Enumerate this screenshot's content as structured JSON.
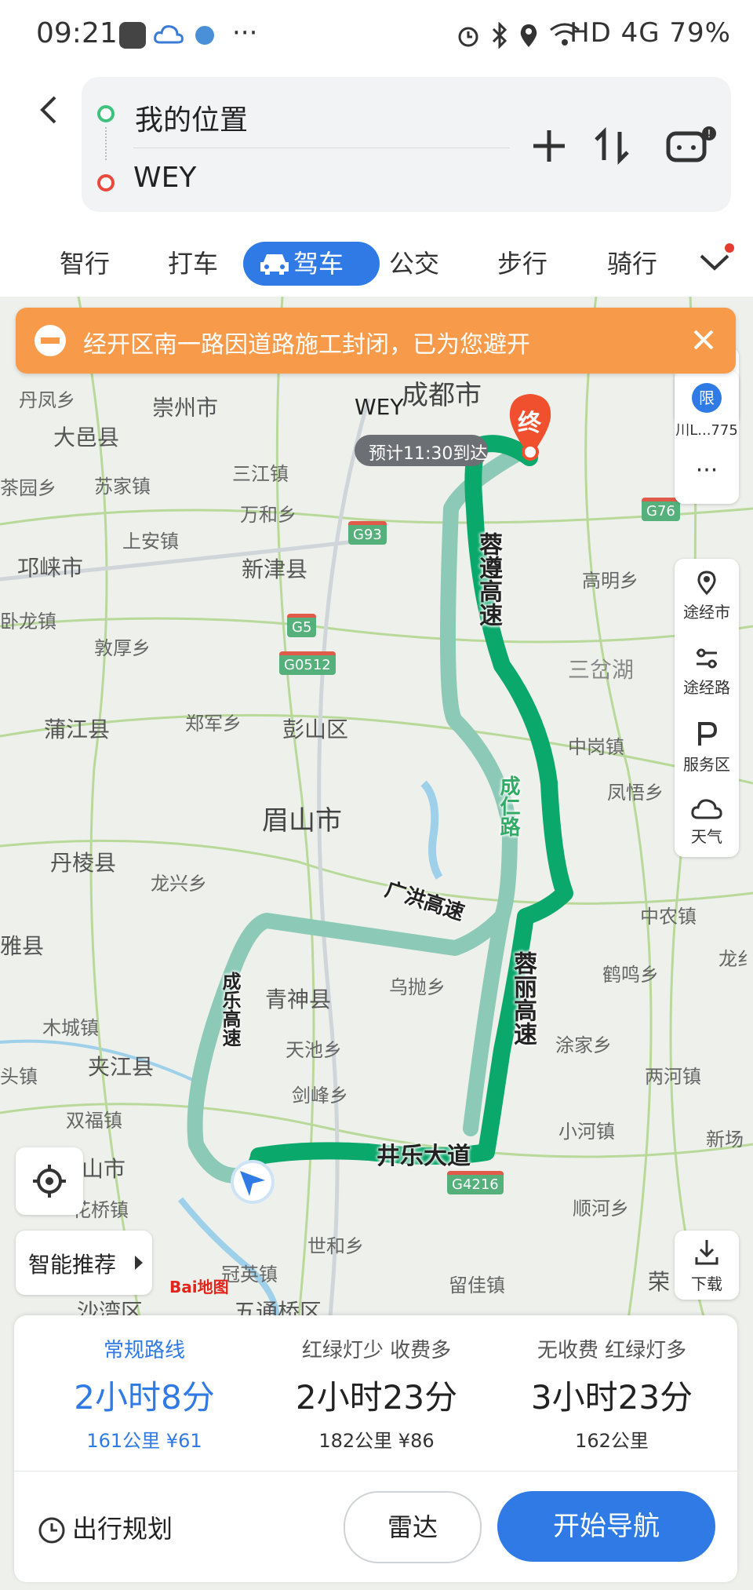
{
  "status": {
    "time": "09:21",
    "right_text": "HD 4G 79%"
  },
  "header": {
    "origin": "我的位置",
    "destination": "WEY",
    "icons": [
      "back-icon",
      "add-icon",
      "swap-icon",
      "robot-icon"
    ]
  },
  "tabs": [
    {
      "label": "智行"
    },
    {
      "label": "打车"
    },
    {
      "label": "驾车",
      "active": true
    },
    {
      "label": "公交"
    },
    {
      "label": "步行"
    },
    {
      "label": "骑行"
    }
  ],
  "alert": {
    "text": "经开区南一路因道路施工封闭，已为您避开"
  },
  "map": {
    "destination_marker": "终",
    "destination_label": "WEY",
    "eta_label": "预计11:30到达",
    "places": [
      {
        "name": "成都市"
      },
      {
        "name": "崇州市"
      },
      {
        "name": "大邑县"
      },
      {
        "name": "丹凤乡"
      },
      {
        "name": "苏家镇"
      },
      {
        "name": "茶园乡"
      },
      {
        "name": "三江镇"
      },
      {
        "name": "万和乡"
      },
      {
        "name": "上安镇"
      },
      {
        "name": "邛崃市"
      },
      {
        "name": "新津县"
      },
      {
        "name": "卧龙镇"
      },
      {
        "name": "敦厚乡"
      },
      {
        "name": "高明乡"
      },
      {
        "name": "三岔湖"
      },
      {
        "name": "蒲江县"
      },
      {
        "name": "郑军乡"
      },
      {
        "name": "彭山区"
      },
      {
        "name": "中岗镇"
      },
      {
        "name": "凤悟乡"
      },
      {
        "name": "眉山市"
      },
      {
        "name": "丹棱县"
      },
      {
        "name": "龙兴乡"
      },
      {
        "name": "中农镇"
      },
      {
        "name": "雅县"
      },
      {
        "name": "青神县"
      },
      {
        "name": "乌抛乡"
      },
      {
        "name": "鹤鸣乡"
      },
      {
        "name": "木城镇"
      },
      {
        "name": "天池乡"
      },
      {
        "name": "涂家乡"
      },
      {
        "name": "两河镇"
      },
      {
        "name": "夹江县"
      },
      {
        "name": "剑峰乡"
      },
      {
        "name": "头镇"
      },
      {
        "name": "双福镇"
      },
      {
        "name": "小河镇"
      },
      {
        "name": "新场"
      },
      {
        "name": "山市"
      },
      {
        "name": "花桥镇"
      },
      {
        "name": "顺河乡"
      },
      {
        "name": "世和乡"
      },
      {
        "name": "冠英镇"
      },
      {
        "name": "留佳镇"
      },
      {
        "name": "荣"
      },
      {
        "name": "沙湾区"
      },
      {
        "name": "五通桥区"
      },
      {
        "name": "龙纟"
      }
    ],
    "roads": [
      {
        "name": "蓉遵高速"
      },
      {
        "name": "成仁路"
      },
      {
        "name": "广洪高速"
      },
      {
        "name": "蓉丽高速"
      },
      {
        "name": "成乐高速"
      },
      {
        "name": "井乐大道"
      }
    ],
    "shields": [
      "G93",
      "G5",
      "G0512",
      "G4216",
      "G76"
    ],
    "restriction_label": "川L...775",
    "restriction_badge": "限",
    "more_label": "···",
    "tools": [
      {
        "label": "途经市"
      },
      {
        "label": "途经路"
      },
      {
        "label": "服务区"
      },
      {
        "label": "天气"
      }
    ],
    "smart_recommend": "智能推荐",
    "download": "下载",
    "logo_text": "Bai地图"
  },
  "routes": [
    {
      "label": "常规路线",
      "time": "2小时8分",
      "detail": "161公里  ¥61",
      "selected": true
    },
    {
      "label": "红绿灯少  收费多",
      "time": "2小时23分",
      "detail": "182公里  ¥86"
    },
    {
      "label": "无收费  红绿灯多",
      "time": "3小时23分",
      "detail": "162公里"
    }
  ],
  "actions": {
    "plan": "出行规划",
    "radar": "雷达",
    "navigate": "开始导航"
  },
  "colors": {
    "accent": "#2f7ae5",
    "route_main": "#0aa86a",
    "route_alt": "#8cc9b6",
    "alert": "#f79b4b",
    "destination": "#f1502f"
  }
}
